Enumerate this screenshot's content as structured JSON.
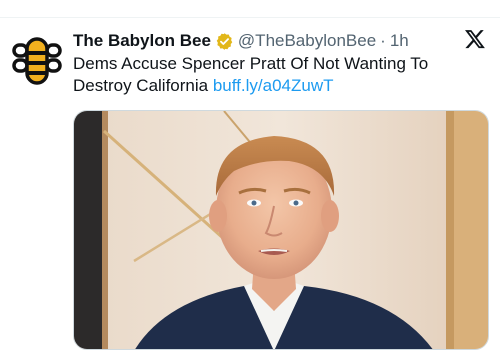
{
  "tweet": {
    "display_name": "The Babylon Bee",
    "handle": "@TheBabylonBee",
    "separator": "·",
    "time": "1h",
    "text": "Dems Accuse Spencer Pratt Of Not Wanting To Destroy California",
    "link": "buff.ly/a04ZuwT"
  },
  "icons": {
    "avatar": "bee-logo-icon",
    "verified": "gold-verified-badge-icon",
    "platform": "x-logo-icon"
  },
  "colors": {
    "text": "#0f1419",
    "secondary": "#536471",
    "link": "#1d9bf0",
    "verified_gold": "#e2b719"
  }
}
